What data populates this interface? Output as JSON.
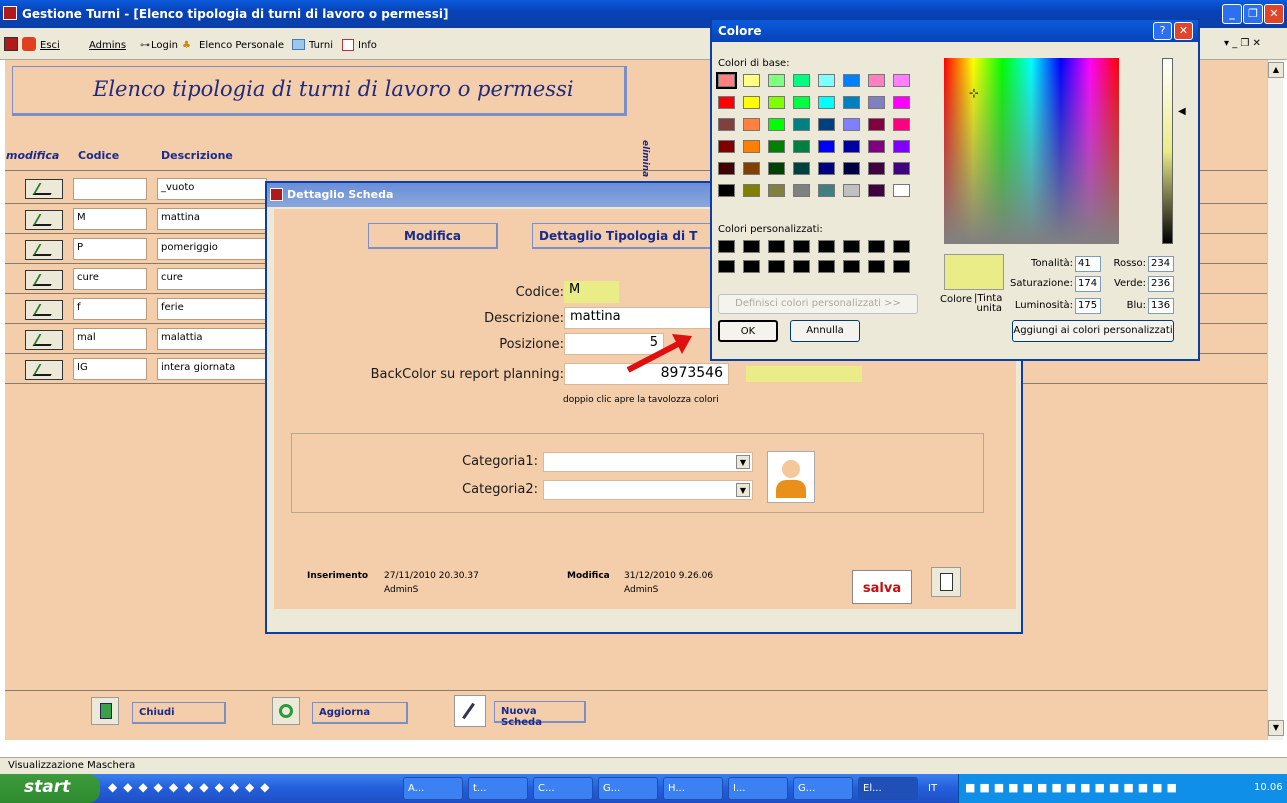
{
  "window": {
    "title": "Gestione Turni - [Elenco tipologia di turni di lavoro o permessi]"
  },
  "menu": {
    "esci": "Esci",
    "admins": "Admins",
    "login": "Login",
    "personale": "Elenco Personale",
    "turni": "Turni",
    "info": "Info"
  },
  "form": {
    "title": "Elenco tipologia di turni di lavoro o permessi",
    "col_modifica": "modifica",
    "col_codice": "Codice",
    "col_descrizione": "Descrizione",
    "col_elimina": "elimina",
    "rows": [
      {
        "code": "",
        "desc": "_vuoto"
      },
      {
        "code": "M",
        "desc": "mattina"
      },
      {
        "code": "P",
        "desc": "pomeriggio"
      },
      {
        "code": "cure",
        "desc": "cure"
      },
      {
        "code": "f",
        "desc": "ferie"
      },
      {
        "code": "mal",
        "desc": "malattia"
      },
      {
        "code": "IG",
        "desc": "intera giornata"
      }
    ],
    "btn_chiudi": "Chiudi",
    "btn_aggiorna": "Aggiorna",
    "btn_nuova": "Nuova Scheda"
  },
  "status": "Visualizzazione Maschera",
  "detail": {
    "title": "Dettaglio Scheda",
    "tab_modifica": "Modifica",
    "tab_dettaglio": "Dettaglio Tipologia di T",
    "lbl_codice": "Codice:",
    "codice": "M",
    "lbl_descrizione": "Descrizione:",
    "descrizione": "mattina",
    "lbl_posizione": "Posizione:",
    "posizione": "5",
    "lbl_backcolor": "BackColor su report planning:",
    "backcolor": "8973546",
    "hint": "doppio clic apre la tavolozza colori",
    "lbl_cat1": "Categoria1:",
    "lbl_cat2": "Categoria2:",
    "lbl_inserimento": "Inserimento",
    "ins_date": "27/11/2010 20.30.37",
    "ins_user": "AdminS",
    "lbl_modifica": "Modifica",
    "mod_date": "31/12/2010 9.26.06",
    "mod_user": "AdminS",
    "btn_salva": "salva",
    "swatch_color": "#eaec88"
  },
  "colore": {
    "title": "Colore",
    "basic_label": "Colori di base:",
    "custom_label": "Colori personalizzati:",
    "define_btn": "Definisci colori personalizzati >>",
    "ok": "OK",
    "cancel": "Annulla",
    "colore_label": "Colore",
    "tinta_label": "|Tinta unita",
    "tonalita_lbl": "Tonalità:",
    "tonalita": "41",
    "saturazione_lbl": "Saturazione:",
    "saturazione": "174",
    "luminosita_lbl": "Luminosità:",
    "luminosita": "175",
    "rosso_lbl": "Rosso:",
    "rosso": "234",
    "verde_lbl": "Verde:",
    "verde": "236",
    "blu_lbl": "Blu:",
    "blu": "136",
    "add_btn": "Aggiungi ai colori personalizzati",
    "basic_colors": [
      "#ff8080",
      "#ffff80",
      "#80ff80",
      "#00ff80",
      "#80ffff",
      "#0080ff",
      "#ff80c0",
      "#ff80ff",
      "#ff0000",
      "#ffff00",
      "#80ff00",
      "#00ff40",
      "#00ffff",
      "#0080c0",
      "#8080c0",
      "#ff00ff",
      "#804040",
      "#ff8040",
      "#00ff00",
      "#008080",
      "#004080",
      "#8080ff",
      "#800040",
      "#ff0080",
      "#800000",
      "#ff8000",
      "#008000",
      "#008040",
      "#0000ff",
      "#0000a0",
      "#800080",
      "#8000ff",
      "#400000",
      "#804000",
      "#004000",
      "#004040",
      "#000080",
      "#000040",
      "#400040",
      "#400080",
      "#000000",
      "#808000",
      "#808040",
      "#808080",
      "#408080",
      "#c0c0c0",
      "#400040",
      "#ffffff"
    ]
  },
  "taskbar": {
    "start": "start",
    "lang": "IT",
    "clock": "10.06",
    "items": [
      "A...",
      "t...",
      "C...",
      "G...",
      "H...",
      "I...",
      "G...",
      "El..."
    ]
  }
}
